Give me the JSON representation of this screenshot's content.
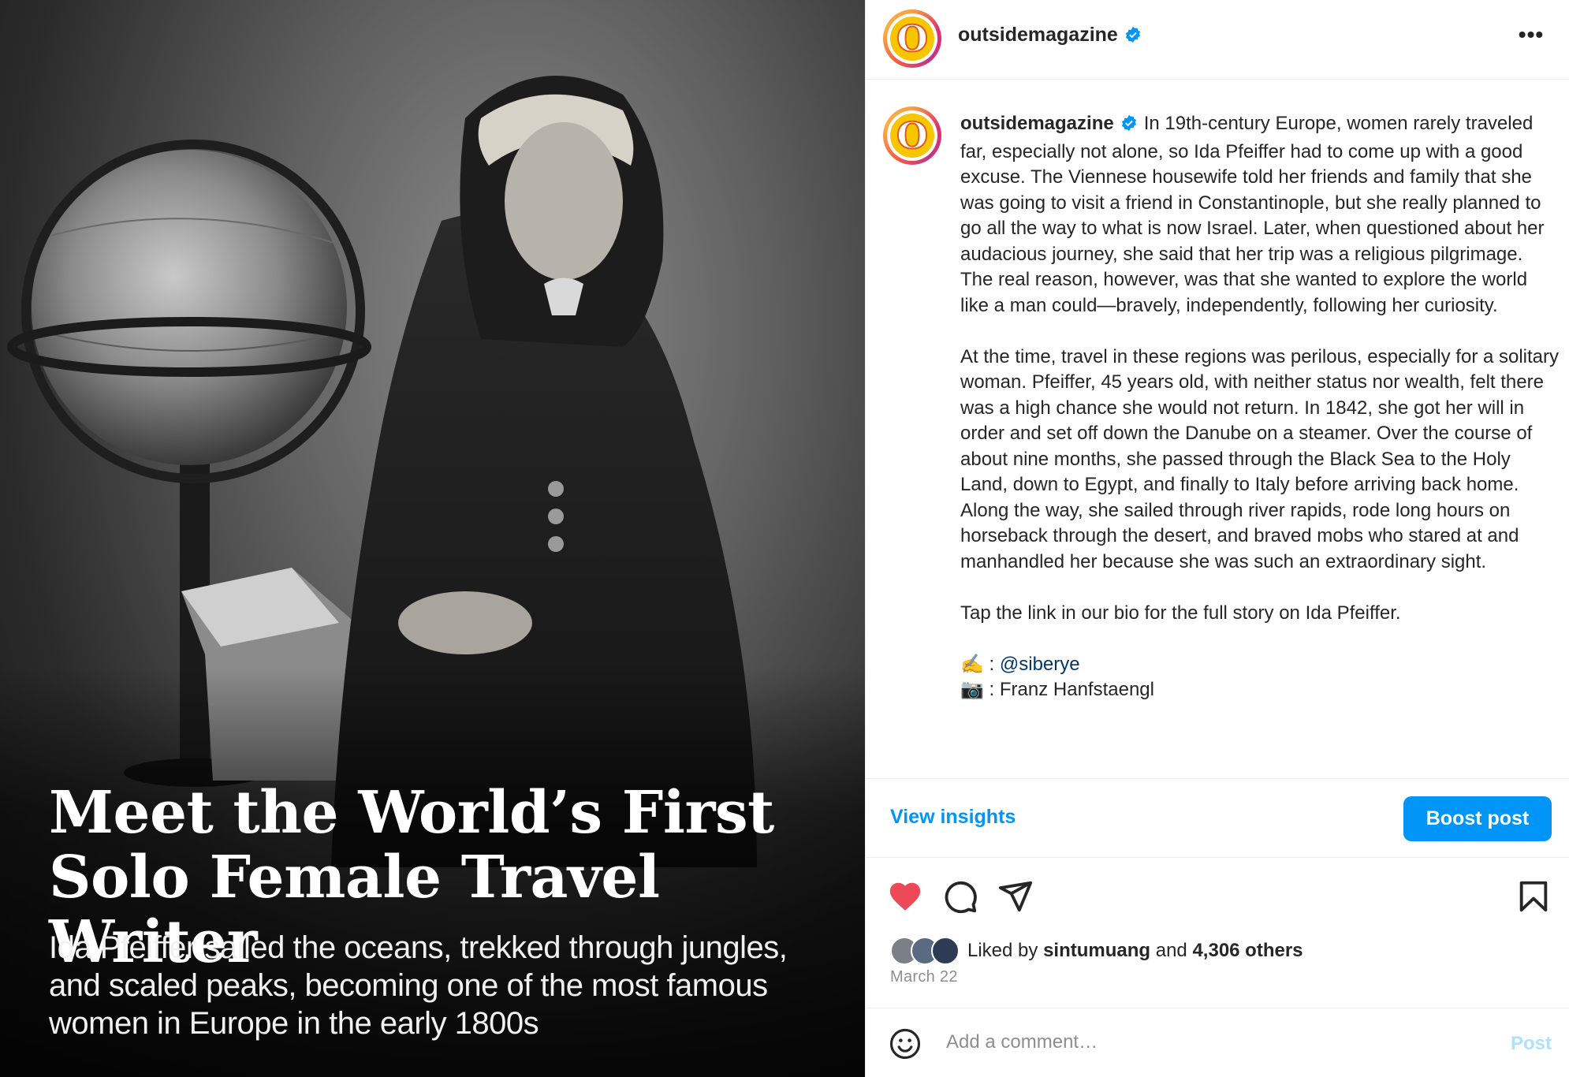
{
  "media": {
    "headline": "Meet the World’s First Solo Female Travel Writer",
    "subheadline": "Ida Pfeiffer sailed the oceans, trekked through jungles, and scaled peaks, becoming one of the most famous women in Europe in the early 1800s"
  },
  "header": {
    "username": "outsidemagazine",
    "verified_icon": "verified-badge-icon",
    "more_icon": "more-options-icon",
    "more_label": "•••"
  },
  "caption": {
    "username": "outsidemagazine",
    "paragraph1": "In 19th-century Europe, women rarely traveled far, especially not alone, so Ida Pfeiffer had to come up with a good excuse. The Viennese housewife told her friends and family that she was going to visit a friend in Constantinople, but she really planned to go all the way to what is now Israel. Later, when questioned about her audacious journey, she said that her trip was a religious pilgrimage. The real reason, however, was that she wanted to explore the world like a man could—bravely, independently, following her curiosity.",
    "paragraph2": "At the time, travel in these regions was perilous, especially for a solitary woman. Pfeiffer, 45 years old, with neither status nor wealth, felt there was a high chance she would not return. In 1842, she got her will in order and set off down the Danube on a steamer. Over the course of about nine months, she passed through the Black Sea to the Holy Land, down to Egypt, and finally to Italy before arriving back home. Along the way, she sailed through river rapids, rode long hours on horseback through the desert, and braved mobs who stared at and manhandled her because she was such an extraordinary sight.",
    "paragraph3": "Tap the link in our bio for the full story on Ida Pfeiffer.",
    "credit_writer_prefix": "✍️ : ",
    "credit_writer_handle": "@siberye",
    "credit_photo": "📷 : Franz Hanfstaengl"
  },
  "insights": {
    "view_label": "View insights",
    "boost_label": "Boost post"
  },
  "actions": {
    "liked": true,
    "like_color": "#ed4956",
    "liked_by_prefix": "Liked by ",
    "liked_by_user": "sintumuang",
    "liked_by_and": " and ",
    "liked_by_others": "4,306 others",
    "date": "March 22"
  },
  "comment": {
    "placeholder": "Add a comment…",
    "post_label": "Post"
  },
  "colors": {
    "accent": "#0095f6",
    "like": "#ed4956",
    "mention": "#00376b"
  }
}
